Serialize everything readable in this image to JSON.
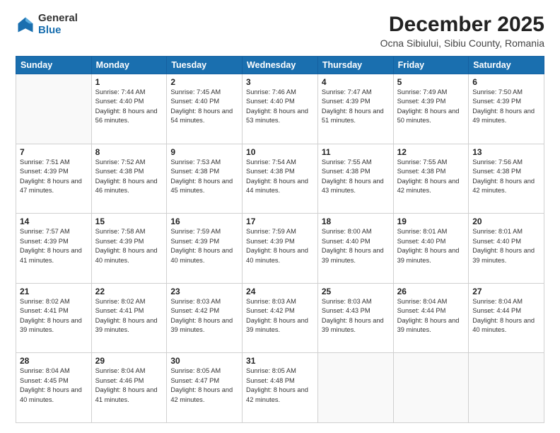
{
  "header": {
    "logo_general": "General",
    "logo_blue": "Blue",
    "title": "December 2025",
    "subtitle": "Ocna Sibiului, Sibiu County, Romania"
  },
  "calendar": {
    "days_of_week": [
      "Sunday",
      "Monday",
      "Tuesday",
      "Wednesday",
      "Thursday",
      "Friday",
      "Saturday"
    ],
    "weeks": [
      [
        {
          "day": "",
          "info": ""
        },
        {
          "day": "1",
          "info": "Sunrise: 7:44 AM\nSunset: 4:40 PM\nDaylight: 8 hours\nand 56 minutes."
        },
        {
          "day": "2",
          "info": "Sunrise: 7:45 AM\nSunset: 4:40 PM\nDaylight: 8 hours\nand 54 minutes."
        },
        {
          "day": "3",
          "info": "Sunrise: 7:46 AM\nSunset: 4:40 PM\nDaylight: 8 hours\nand 53 minutes."
        },
        {
          "day": "4",
          "info": "Sunrise: 7:47 AM\nSunset: 4:39 PM\nDaylight: 8 hours\nand 51 minutes."
        },
        {
          "day": "5",
          "info": "Sunrise: 7:49 AM\nSunset: 4:39 PM\nDaylight: 8 hours\nand 50 minutes."
        },
        {
          "day": "6",
          "info": "Sunrise: 7:50 AM\nSunset: 4:39 PM\nDaylight: 8 hours\nand 49 minutes."
        }
      ],
      [
        {
          "day": "7",
          "info": "Sunrise: 7:51 AM\nSunset: 4:39 PM\nDaylight: 8 hours\nand 47 minutes."
        },
        {
          "day": "8",
          "info": "Sunrise: 7:52 AM\nSunset: 4:38 PM\nDaylight: 8 hours\nand 46 minutes."
        },
        {
          "day": "9",
          "info": "Sunrise: 7:53 AM\nSunset: 4:38 PM\nDaylight: 8 hours\nand 45 minutes."
        },
        {
          "day": "10",
          "info": "Sunrise: 7:54 AM\nSunset: 4:38 PM\nDaylight: 8 hours\nand 44 minutes."
        },
        {
          "day": "11",
          "info": "Sunrise: 7:55 AM\nSunset: 4:38 PM\nDaylight: 8 hours\nand 43 minutes."
        },
        {
          "day": "12",
          "info": "Sunrise: 7:55 AM\nSunset: 4:38 PM\nDaylight: 8 hours\nand 42 minutes."
        },
        {
          "day": "13",
          "info": "Sunrise: 7:56 AM\nSunset: 4:38 PM\nDaylight: 8 hours\nand 42 minutes."
        }
      ],
      [
        {
          "day": "14",
          "info": "Sunrise: 7:57 AM\nSunset: 4:39 PM\nDaylight: 8 hours\nand 41 minutes."
        },
        {
          "day": "15",
          "info": "Sunrise: 7:58 AM\nSunset: 4:39 PM\nDaylight: 8 hours\nand 40 minutes."
        },
        {
          "day": "16",
          "info": "Sunrise: 7:59 AM\nSunset: 4:39 PM\nDaylight: 8 hours\nand 40 minutes."
        },
        {
          "day": "17",
          "info": "Sunrise: 7:59 AM\nSunset: 4:39 PM\nDaylight: 8 hours\nand 40 minutes."
        },
        {
          "day": "18",
          "info": "Sunrise: 8:00 AM\nSunset: 4:40 PM\nDaylight: 8 hours\nand 39 minutes."
        },
        {
          "day": "19",
          "info": "Sunrise: 8:01 AM\nSunset: 4:40 PM\nDaylight: 8 hours\nand 39 minutes."
        },
        {
          "day": "20",
          "info": "Sunrise: 8:01 AM\nSunset: 4:40 PM\nDaylight: 8 hours\nand 39 minutes."
        }
      ],
      [
        {
          "day": "21",
          "info": "Sunrise: 8:02 AM\nSunset: 4:41 PM\nDaylight: 8 hours\nand 39 minutes."
        },
        {
          "day": "22",
          "info": "Sunrise: 8:02 AM\nSunset: 4:41 PM\nDaylight: 8 hours\nand 39 minutes."
        },
        {
          "day": "23",
          "info": "Sunrise: 8:03 AM\nSunset: 4:42 PM\nDaylight: 8 hours\nand 39 minutes."
        },
        {
          "day": "24",
          "info": "Sunrise: 8:03 AM\nSunset: 4:42 PM\nDaylight: 8 hours\nand 39 minutes."
        },
        {
          "day": "25",
          "info": "Sunrise: 8:03 AM\nSunset: 4:43 PM\nDaylight: 8 hours\nand 39 minutes."
        },
        {
          "day": "26",
          "info": "Sunrise: 8:04 AM\nSunset: 4:44 PM\nDaylight: 8 hours\nand 39 minutes."
        },
        {
          "day": "27",
          "info": "Sunrise: 8:04 AM\nSunset: 4:44 PM\nDaylight: 8 hours\nand 40 minutes."
        }
      ],
      [
        {
          "day": "28",
          "info": "Sunrise: 8:04 AM\nSunset: 4:45 PM\nDaylight: 8 hours\nand 40 minutes."
        },
        {
          "day": "29",
          "info": "Sunrise: 8:04 AM\nSunset: 4:46 PM\nDaylight: 8 hours\nand 41 minutes."
        },
        {
          "day": "30",
          "info": "Sunrise: 8:05 AM\nSunset: 4:47 PM\nDaylight: 8 hours\nand 42 minutes."
        },
        {
          "day": "31",
          "info": "Sunrise: 8:05 AM\nSunset: 4:48 PM\nDaylight: 8 hours\nand 42 minutes."
        },
        {
          "day": "",
          "info": ""
        },
        {
          "day": "",
          "info": ""
        },
        {
          "day": "",
          "info": ""
        }
      ]
    ]
  }
}
